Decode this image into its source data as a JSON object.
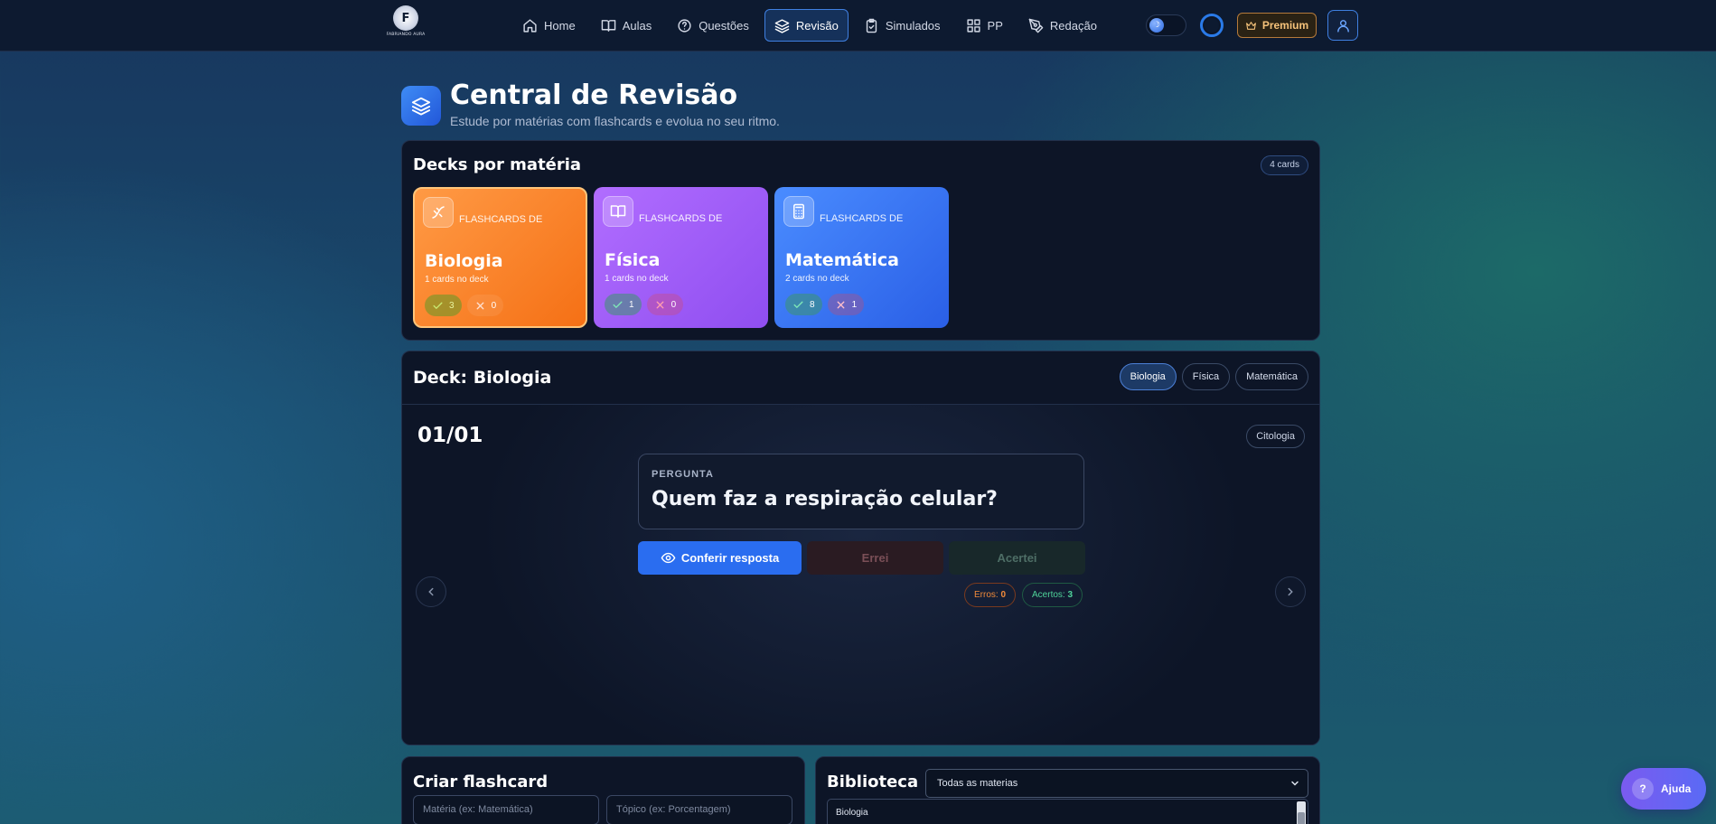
{
  "colors": {
    "accent": "#2a6df0",
    "biologia": "#f57015",
    "fisica": "#8f4ef0",
    "matematica": "#2a5fe6",
    "premium": "#f5c27a",
    "success": "#4fd39a",
    "error": "#f08a3a"
  },
  "brand": {
    "logo_glyph": "F",
    "logo_text": "FABRIANDO AURA"
  },
  "nav": {
    "items": [
      {
        "label": "Home",
        "icon": "home-icon"
      },
      {
        "label": "Aulas",
        "icon": "book-icon"
      },
      {
        "label": "Questões",
        "icon": "help-circle-icon"
      },
      {
        "label": "Revisão",
        "icon": "layers-icon"
      },
      {
        "label": "Simulados",
        "icon": "clipboard-check-icon"
      },
      {
        "label": "PP",
        "icon": "grid-icon"
      },
      {
        "label": "Redação",
        "icon": "pen-tool-icon"
      }
    ],
    "active": "Revisão",
    "premium_label": "Premium"
  },
  "header": {
    "title": "Central de Revisão",
    "subtitle": "Estude por matérias com flashcards e evolua no seu ritmo."
  },
  "decks_panel": {
    "title": "Decks por matéria",
    "count_badge": "4 cards",
    "decks": [
      {
        "kicker": "FLASHCARDS DE",
        "name": "Biologia",
        "count": "1 cards no deck",
        "correct": "3",
        "wrong": "0",
        "icon": "dna-icon"
      },
      {
        "kicker": "FLASHCARDS DE",
        "name": "Física",
        "count": "1 cards no deck",
        "correct": "1",
        "wrong": "0",
        "icon": "open-book-icon"
      },
      {
        "kicker": "FLASHCARDS DE",
        "name": "Matemática",
        "count": "2 cards no deck",
        "correct": "8",
        "wrong": "1",
        "icon": "calculator-icon"
      }
    ]
  },
  "study": {
    "title": "Deck: Biologia",
    "tabs": [
      "Biologia",
      "Física",
      "Matemática"
    ],
    "active_tab": "Biologia",
    "progress": "01/01",
    "topic": "Citologia",
    "question_label": "PERGUNTA",
    "question": "Quem faz a respiração celular?",
    "reveal_label": "Conferir resposta",
    "wrong_label": "Errei",
    "right_label": "Acertei",
    "errors_label": "Erros:",
    "errors_value": "0",
    "hits_label": "Acertos:",
    "hits_value": "3"
  },
  "create": {
    "title": "Criar flashcard",
    "materia_placeholder": "Matéria (ex: Matemática)",
    "topico_placeholder": "Tópico (ex: Porcentagem)"
  },
  "library": {
    "title": "Biblioteca",
    "filter_value": "Todas as materias",
    "items": [
      "Biologia"
    ]
  },
  "help": {
    "glyph": "?",
    "label": "Ajuda"
  }
}
